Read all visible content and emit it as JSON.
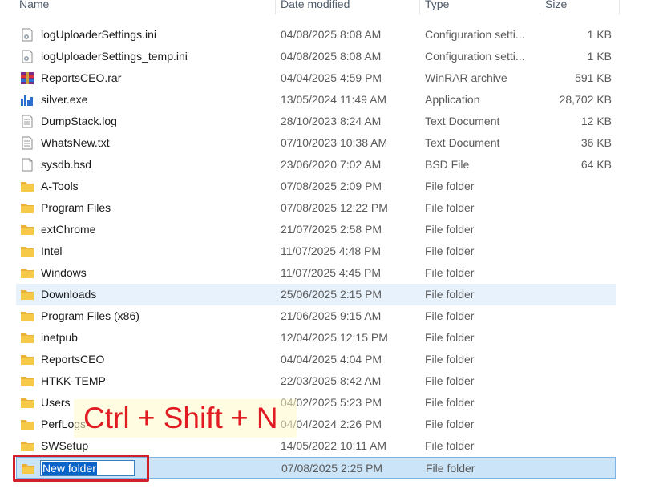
{
  "columns": {
    "name": "Name",
    "date": "Date modified",
    "type": "Type",
    "size": "Size"
  },
  "files": [
    {
      "name": "logUploaderSettings.ini",
      "date": "04/08/2025 8:08 AM",
      "type": "Configuration setti...",
      "size": "1 KB",
      "icon": "ini-file-icon"
    },
    {
      "name": "logUploaderSettings_temp.ini",
      "date": "04/08/2025 8:08 AM",
      "type": "Configuration setti...",
      "size": "1 KB",
      "icon": "ini-file-icon"
    },
    {
      "name": "ReportsCEO.rar",
      "date": "04/04/2025 4:59 PM",
      "type": "WinRAR archive",
      "size": "591 KB",
      "icon": "winrar-icon"
    },
    {
      "name": "silver.exe",
      "date": "13/05/2024 11:49 AM",
      "type": "Application",
      "size": "28,702 KB",
      "icon": "exe-icon"
    },
    {
      "name": "DumpStack.log",
      "date": "28/10/2023 8:24 AM",
      "type": "Text Document",
      "size": "12 KB",
      "icon": "text-file-icon"
    },
    {
      "name": "WhatsNew.txt",
      "date": "07/10/2023 10:38 AM",
      "type": "Text Document",
      "size": "36 KB",
      "icon": "text-file-icon"
    },
    {
      "name": "sysdb.bsd",
      "date": "23/06/2020 7:02 AM",
      "type": "BSD File",
      "size": "64 KB",
      "icon": "blank-file-icon"
    },
    {
      "name": "A-Tools",
      "date": "07/08/2025 2:09 PM",
      "type": "File folder",
      "size": "",
      "icon": "folder-icon"
    },
    {
      "name": "Program Files",
      "date": "07/08/2025 12:22 PM",
      "type": "File folder",
      "size": "",
      "icon": "folder-icon"
    },
    {
      "name": "extChrome",
      "date": "21/07/2025 2:58 PM",
      "type": "File folder",
      "size": "",
      "icon": "folder-icon"
    },
    {
      "name": "Intel",
      "date": "11/07/2025 4:48 PM",
      "type": "File folder",
      "size": "",
      "icon": "folder-icon"
    },
    {
      "name": "Windows",
      "date": "11/07/2025 4:45 PM",
      "type": "File folder",
      "size": "",
      "icon": "folder-icon"
    },
    {
      "name": "Downloads",
      "date": "25/06/2025 2:15 PM",
      "type": "File folder",
      "size": "",
      "icon": "folder-icon",
      "state": "hover"
    },
    {
      "name": "Program Files (x86)",
      "date": "21/06/2025 9:15 AM",
      "type": "File folder",
      "size": "",
      "icon": "folder-icon"
    },
    {
      "name": "inetpub",
      "date": "12/04/2025 12:15 PM",
      "type": "File folder",
      "size": "",
      "icon": "folder-icon"
    },
    {
      "name": "ReportsCEO",
      "date": "04/04/2025 4:04 PM",
      "type": "File folder",
      "size": "",
      "icon": "folder-icon"
    },
    {
      "name": "HTKK-TEMP",
      "date": "22/03/2025 8:42 AM",
      "type": "File folder",
      "size": "",
      "icon": "folder-icon"
    },
    {
      "name": "Users",
      "date": "04/02/2025 5:23 PM",
      "type": "File folder",
      "size": "",
      "icon": "folder-icon"
    },
    {
      "name": "PerfLogs",
      "date": "04/04/2024 2:26 PM",
      "type": "File folder",
      "size": "",
      "icon": "folder-icon"
    },
    {
      "name": "SWSetup",
      "date": "14/05/2022 10:11 AM",
      "type": "File folder",
      "size": "",
      "icon": "folder-icon"
    },
    {
      "name": "New folder",
      "date": "07/08/2025 2:25 PM",
      "type": "File folder",
      "size": "",
      "icon": "folder-icon",
      "state": "renaming"
    }
  ],
  "overlay": {
    "shortcut_text": "Ctrl + Shift + N",
    "annotation_color": "#e11b22"
  },
  "colors": {
    "hover_bg": "#e8f2fc",
    "selected_bg": "#cce4f7",
    "folder_yellow": "#f7c948"
  }
}
